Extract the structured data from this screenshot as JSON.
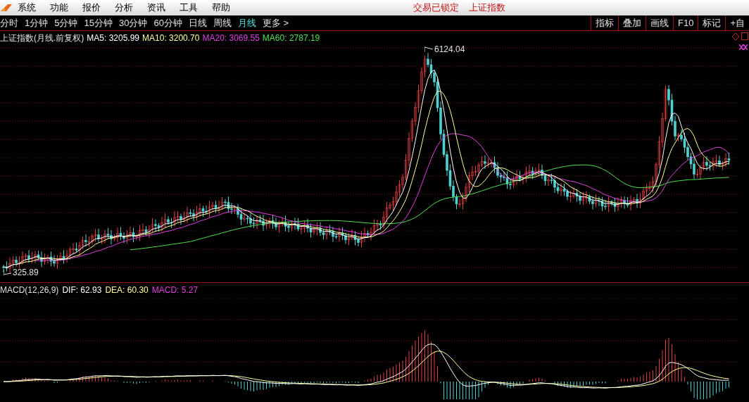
{
  "menu_bar": {
    "items": [
      "系统",
      "功能",
      "报价",
      "分析",
      "资讯",
      "工具",
      "帮助"
    ],
    "status": [
      "交易已锁定",
      "上证指数"
    ]
  },
  "period_tabs": [
    {
      "label": "分时",
      "selected": false
    },
    {
      "label": "1分钟",
      "selected": false
    },
    {
      "label": "5分钟",
      "selected": false
    },
    {
      "label": "15分钟",
      "selected": false
    },
    {
      "label": "30分钟",
      "selected": false
    },
    {
      "label": "60分钟",
      "selected": false
    },
    {
      "label": "日线",
      "selected": false
    },
    {
      "label": "周线",
      "selected": false
    },
    {
      "label": "月线",
      "selected": true
    },
    {
      "label": "更多 >",
      "selected": false
    }
  ],
  "tool_buttons": [
    "指标",
    "叠加",
    "画线",
    "F10",
    "标记",
    "+自"
  ],
  "main_chart": {
    "title": "上证指数(月线.前复权)",
    "indicators": [
      {
        "text": "MA5: 3205.99",
        "color": "#ffffff"
      },
      {
        "text": "MA10: 3200.70",
        "color": "#ffff99"
      },
      {
        "text": "MA20: 3069.55",
        "color": "#e040e0"
      },
      {
        "text": "MA60: 2787.19",
        "color": "#50e050"
      }
    ],
    "high_label": "6124.04",
    "low_label": "325.89"
  },
  "macd_panel": {
    "title": "MACD(12,26,9)",
    "indicators": [
      {
        "text": "DIF: 62.93",
        "color": "#ffffff"
      },
      {
        "text": "DEA: 60.30",
        "color": "#ffff99"
      },
      {
        "text": "MACD: 5.27",
        "color": "#e040e0"
      }
    ]
  }
}
